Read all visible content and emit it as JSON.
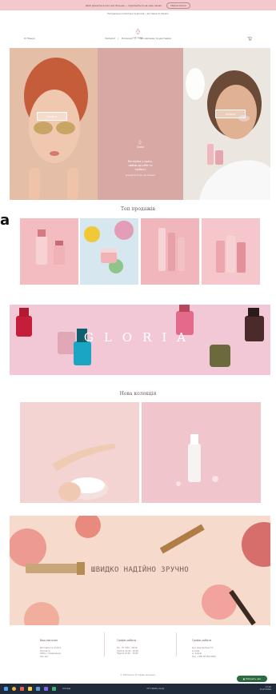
{
  "announcement": {
    "message": "Щоб дізнатися про нас більше — підпишіться на наш канал",
    "button": "Підписатися"
  },
  "header": {
    "subtitle": "Натуральна косметика та догляд • доставка по Україні",
    "logo": "Gloria"
  },
  "nav": {
    "search_placeholder": "Q Пошук",
    "links": [
      "Каталог",
      "Колекції",
      "Про магазин та доставка"
    ]
  },
  "hero": {
    "left_button": "КУПИТИ",
    "right_button": "КУПИТИ",
    "mid_logo": "Gloria",
    "mid_tagline": "Ми вірімо у красу",
    "mid_lines": [
      "Ми вірімо у красу,",
      "любов до себе та",
      "турботу"
    ],
    "mid_caption": "Дізнайтеся про нас більше"
  },
  "sections": {
    "top_sales": "Топ продажів",
    "new_collection": "Нова колекція"
  },
  "banner": {
    "word": "GLORIA"
  },
  "cosmetics": {
    "slogan": "ШВИДКО НАДІЙНО ЗРУЧНО"
  },
  "footer": {
    "col1": {
      "title": "Ваш магазин",
      "lines": [
        "Доставка та оплата",
        "Контакти",
        "Обмін / повернення",
        "Про нас"
      ]
    },
    "col2": {
      "title": "Графік роботи",
      "lines": [
        "Пн - Пт  9:00 - 18:00",
        "Субота  10:00 - 16:00",
        "Неділя  10:00 - 16:00"
      ]
    },
    "col3": {
      "title": "Графік роботи",
      "lines": [
        "вул. Центральна 7А",
        "м. Київ",
        "м. Харків",
        "Тел. +380 00 000 0000"
      ]
    },
    "copyright": "© 2024 Gloria. Усі права захищено."
  },
  "chat": {
    "label": "Напишіть нам"
  },
  "taskbar": {
    "task_text": "Спогади",
    "tray_top": "17:42",
    "tray_bottom": "12.03.2024",
    "status": "15°C Mostly cloudy"
  },
  "colors": {
    "topbar": "#f3c9cc",
    "hero_mid": "#d8a8a5",
    "banner": "#f3c8d6",
    "cosmetics": "#f6dacb",
    "chat": "#2c6b3f"
  }
}
